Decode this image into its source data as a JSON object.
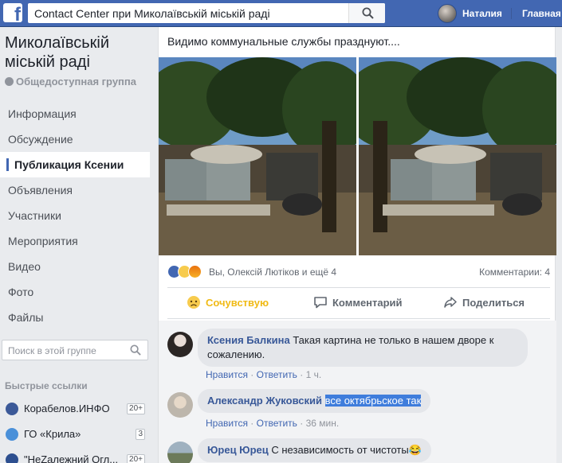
{
  "topbar": {
    "logo": "f",
    "search_value": "Contact Center при Миколаївській міській раді",
    "user_name": "Наталия",
    "home_label": "Главная"
  },
  "sidebar": {
    "group_title": "Миколаївській міській раді",
    "group_type": "Общедоступная группа",
    "nav": [
      {
        "label": "Информация"
      },
      {
        "label": "Обсуждение"
      },
      {
        "label": "Публикация Ксении",
        "active": true
      },
      {
        "label": "Объявления"
      },
      {
        "label": "Участники"
      },
      {
        "label": "Мероприятия"
      },
      {
        "label": "Видео"
      },
      {
        "label": "Фото"
      },
      {
        "label": "Файлы"
      }
    ],
    "search_placeholder": "Поиск в этой группе",
    "quick_links_title": "Быстрые ссылки",
    "quick_links": [
      {
        "label": "Корабелов.ИНФО",
        "count": "20+",
        "color": "#3b5998"
      },
      {
        "label": "ГО «Крила»",
        "count": "3",
        "color": "#4a90d9"
      },
      {
        "label": "\"НеZалежний Огл...",
        "count": "20+",
        "color": "#2d4f8f"
      }
    ]
  },
  "post": {
    "text": "Видимо коммунальные службы празднуют....",
    "reactions_names": "Вы, Олексій Лютіков и ещё 4",
    "comments_count": "Комментарии: 4",
    "actions": {
      "sympathy": "Сочувствую",
      "comment": "Комментарий",
      "share": "Поделиться"
    }
  },
  "comments": [
    {
      "author": "Ксения Балкина",
      "text_line1": "Такая картина не только в нашем дворе к",
      "text_line2": "сожалению.",
      "like": "Нравится",
      "reply": "Ответить",
      "time": "1 ч."
    },
    {
      "author": "Александр Жуковский",
      "text": "все октябрьское так",
      "like": "Нравится",
      "reply": "Ответить",
      "time": "36 мин."
    },
    {
      "author": "Юрец Юрец",
      "text": "С независимость от чистоты",
      "emoji": "😂"
    }
  ],
  "colors": {
    "topbar": "#4267b2",
    "link": "#385898",
    "sympathy": "#f0ba15",
    "selection": "#3f7ddc"
  }
}
